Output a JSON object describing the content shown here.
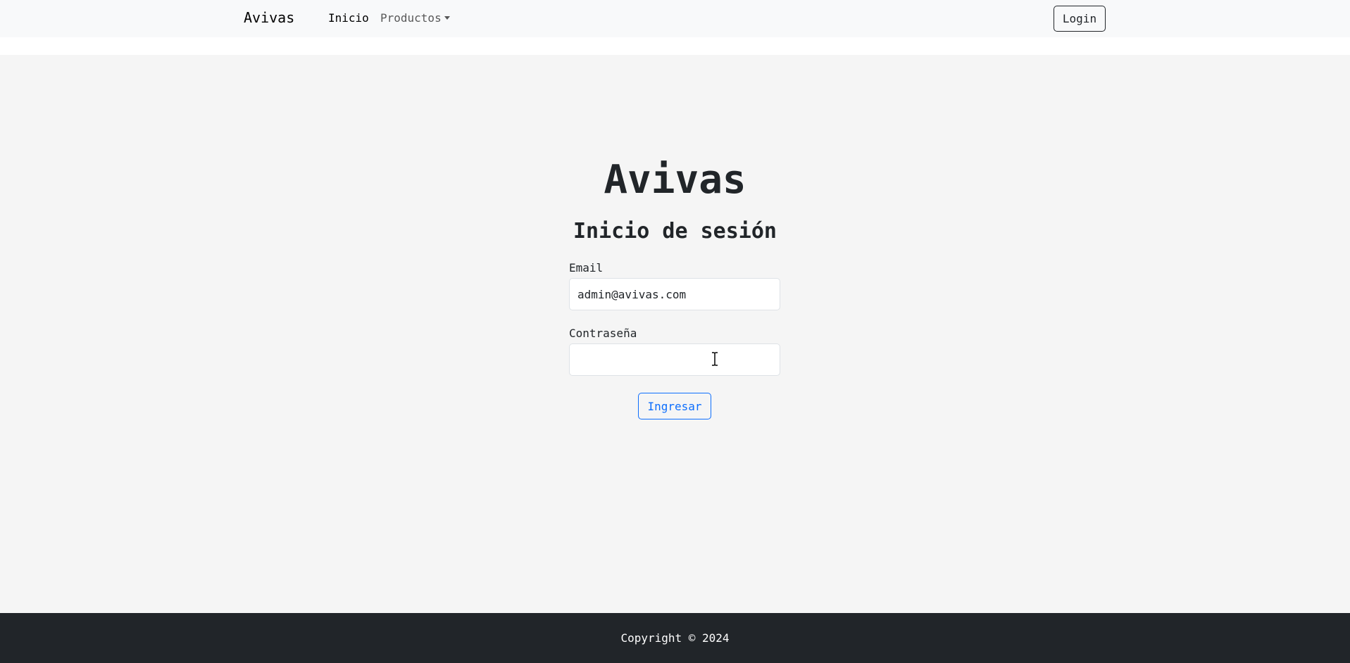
{
  "navbar": {
    "brand": "Avivas",
    "links": [
      {
        "label": "Inicio"
      },
      {
        "label": "Productos"
      }
    ],
    "login_label": "Login"
  },
  "main": {
    "site_title": "Avivas",
    "login_title": "Inicio de sesión",
    "email": {
      "label": "Email",
      "value": "admin@avivas.com"
    },
    "password": {
      "label": "Contraseña",
      "value": ""
    },
    "submit_label": "Ingresar"
  },
  "footer": {
    "copyright": "Copyright © 2024"
  },
  "colors": {
    "primary": "#0d6efd",
    "navbar_bg": "#f8f9fa",
    "main_bg": "#f5f5f5",
    "footer_bg": "#212529"
  },
  "icons": {
    "cursor": "text-cursor-icon",
    "dropdown": "caret-down-icon"
  }
}
